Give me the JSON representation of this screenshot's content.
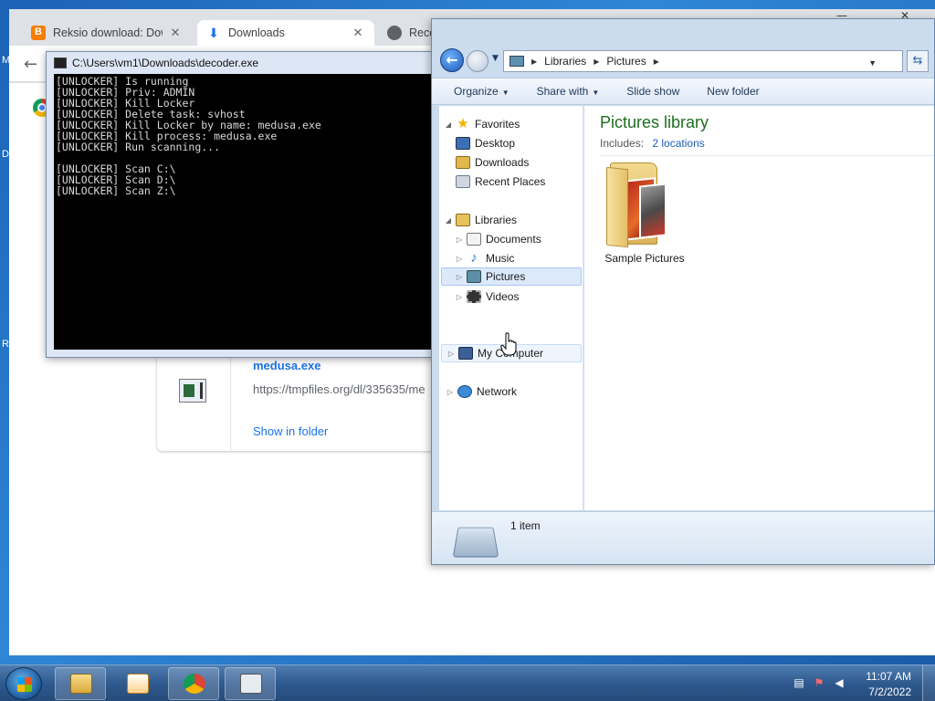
{
  "desktop": {
    "letters": [
      "M",
      "D",
      "R"
    ]
  },
  "chrome": {
    "tabs": [
      {
        "label": "Reksio download: Down",
        "icon": "blogger-icon"
      },
      {
        "label": "Downloads",
        "icon": "download-icon"
      },
      {
        "label": "Recov",
        "icon": "globe-icon"
      }
    ],
    "close_glyph": "✕",
    "back_glyph": "←",
    "download": {
      "file_name": "medusa.exe",
      "url": "https://tmpfiles.org/dl/335635/me",
      "show_in_folder": "Show in folder"
    }
  },
  "console": {
    "title": "C:\\Users\\vm1\\Downloads\\decoder.exe",
    "lines": [
      "[UNLOCKER] Is running",
      "[UNLOCKER] Priv: ADMIN",
      "[UNLOCKER] Kill Locker",
      "[UNLOCKER] Delete task: svhost",
      "[UNLOCKER] Kill Locker by name: medusa.exe",
      "[UNLOCKER] Kill process: medusa.exe",
      "[UNLOCKER] Run scanning...",
      "",
      "[UNLOCKER] Scan C:\\",
      "[UNLOCKER] Scan D:\\",
      "[UNLOCKER] Scan Z:\\"
    ]
  },
  "explorer": {
    "breadcrumbs": [
      "Libraries",
      "Pictures"
    ],
    "commands": [
      "Organize",
      "Share with",
      "Slide show",
      "New folder"
    ],
    "nav": {
      "favorites": "Favorites",
      "desktop": "Desktop",
      "downloads": "Downloads",
      "recent_places": "Recent Places",
      "libraries": "Libraries",
      "documents": "Documents",
      "music": "Music",
      "pictures": "Pictures",
      "videos": "Videos",
      "my_computer": "My Computer",
      "network": "Network"
    },
    "library_title": "Pictures library",
    "includes_label": "Includes:",
    "includes_link": "2 locations",
    "folder_name": "Sample Pictures",
    "item_count": "1 item"
  },
  "taskbar": {
    "time": "11:07 AM",
    "date": "7/2/2022"
  }
}
